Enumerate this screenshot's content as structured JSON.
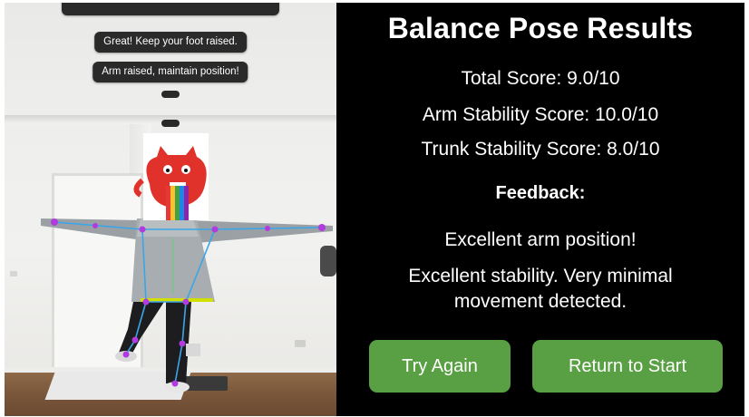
{
  "camera": {
    "feedback_top": "",
    "feedback": [
      "Great! Keep your foot raised.",
      "Arm raised, maintain position!"
    ]
  },
  "results": {
    "title": "Balance Pose Results",
    "total_score": "Total Score: 9.0/10",
    "arm_score": "Arm Stability Score: 10.0/10",
    "trunk_score": "Trunk Stability Score: 8.0/10",
    "feedback_heading": "Feedback:",
    "feedback_lines": [
      "Excellent arm position!",
      "Excellent stability. Very minimal movement detected."
    ]
  },
  "buttons": {
    "try_again": "Try Again",
    "return_to_start": "Return to Start"
  },
  "colors": {
    "button_green": "#58a043",
    "panel_bg": "#000000",
    "bubble_bg": "#2a2a2a",
    "landmark": "#b23be0",
    "skeleton": "#3aa6e8"
  },
  "icons": {
    "face_cover": "red-monster-sticker"
  }
}
